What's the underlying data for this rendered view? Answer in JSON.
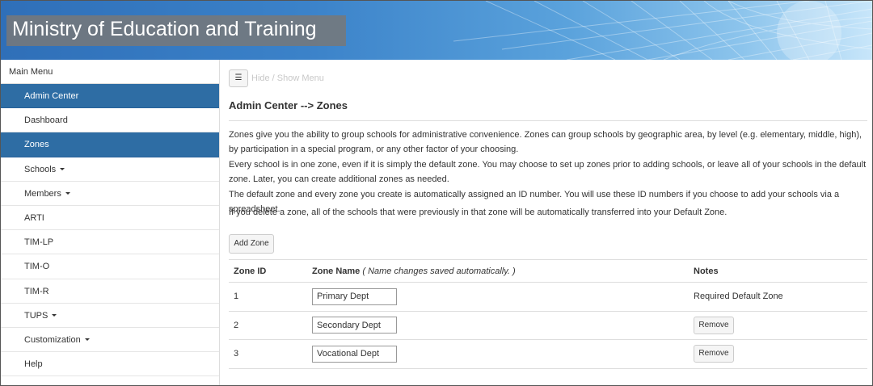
{
  "header": {
    "title": "Ministry of Education and Training"
  },
  "sidebar": {
    "heading": "Main Menu",
    "items": [
      {
        "label": "Admin Center",
        "active": true
      },
      {
        "label": "Dashboard",
        "active": false
      },
      {
        "label": "Zones",
        "active": true
      },
      {
        "label": "Schools",
        "dropdown": true
      },
      {
        "label": "Members",
        "dropdown": true
      },
      {
        "label": "ARTI"
      },
      {
        "label": "TIM-LP"
      },
      {
        "label": "TIM-O"
      },
      {
        "label": "TIM-R"
      },
      {
        "label": "TUPS",
        "dropdown": true
      },
      {
        "label": "Customization",
        "dropdown": true
      },
      {
        "label": "Help"
      }
    ]
  },
  "main": {
    "menu_toggle_icon": "☰",
    "menu_toggle_label": "Hide / Show Menu",
    "title": "Admin Center --> Zones",
    "paragraphs": [
      "Zones give you the ability to group schools for administrative convenience. Zones can group schools by geographic area, by level (e.g. elementary, middle, high), by participation in a special program, or any other factor of your choosing.",
      "Every school is in one zone, even if it is simply the default zone. You may choose to set up zones prior to adding schools, or leave all of your schools in the default zone. Later, you can create additional zones as needed.",
      "The default zone and every zone you create is automatically assigned an ID number. You will use these ID numbers if you choose to add your schools via a spreadsheet.",
      "If you delete a zone, all of the schools that were previously in that zone will be automatically transferred into your Default Zone."
    ],
    "add_zone_label": "Add Zone",
    "table": {
      "headers": {
        "zone_id": "Zone ID",
        "zone_name": "Zone Name",
        "zone_name_hint": "( Name changes saved automatically. )",
        "notes": "Notes"
      },
      "rows": [
        {
          "id": "1",
          "name": "Primary Dept",
          "notes": "Required Default Zone",
          "action": ""
        },
        {
          "id": "2",
          "name": "Secondary Dept",
          "notes": "",
          "action": "Remove"
        },
        {
          "id": "3",
          "name": "Vocational Dept",
          "notes": "",
          "action": "Remove"
        }
      ]
    }
  },
  "colors": {
    "active_nav": "#2e6da4",
    "banner_blue": "#3b82c9"
  }
}
